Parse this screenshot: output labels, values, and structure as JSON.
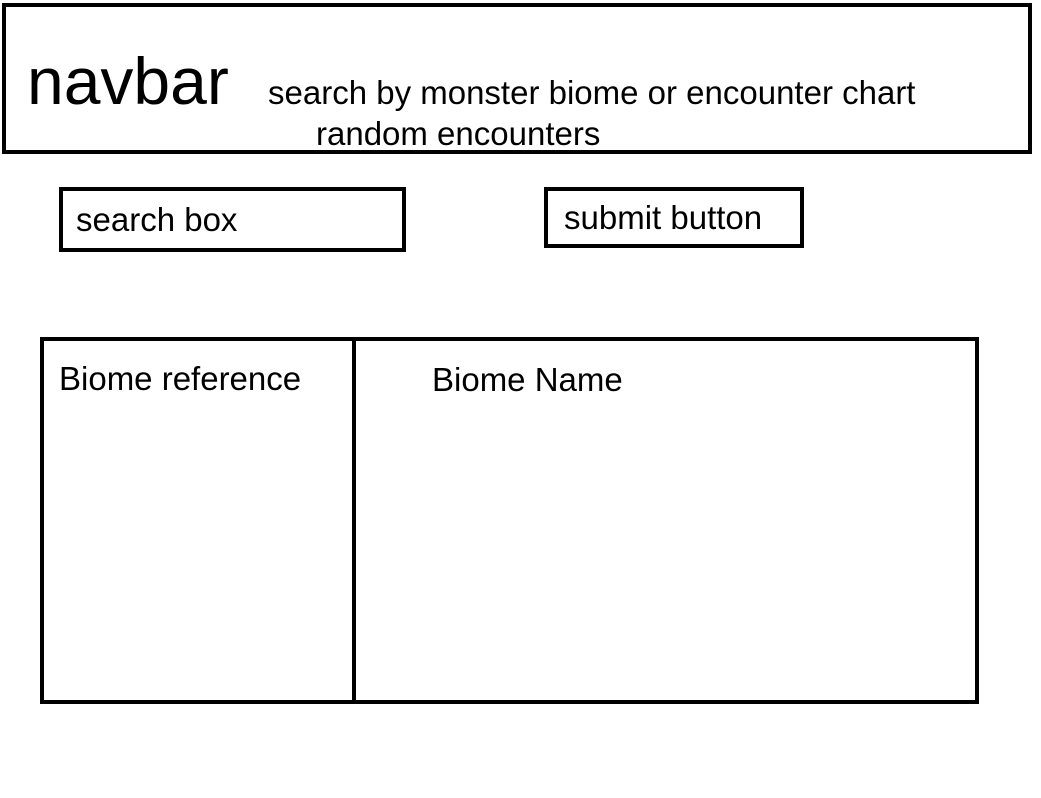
{
  "navbar": {
    "title": "navbar",
    "description_line1": "search by monster biome or encounter chart",
    "description_line2": "random encounters"
  },
  "search": {
    "label": "search box"
  },
  "submit": {
    "label": "submit button"
  },
  "biome_panel": {
    "reference_label": "Biome reference",
    "name_label": "Biome Name"
  }
}
